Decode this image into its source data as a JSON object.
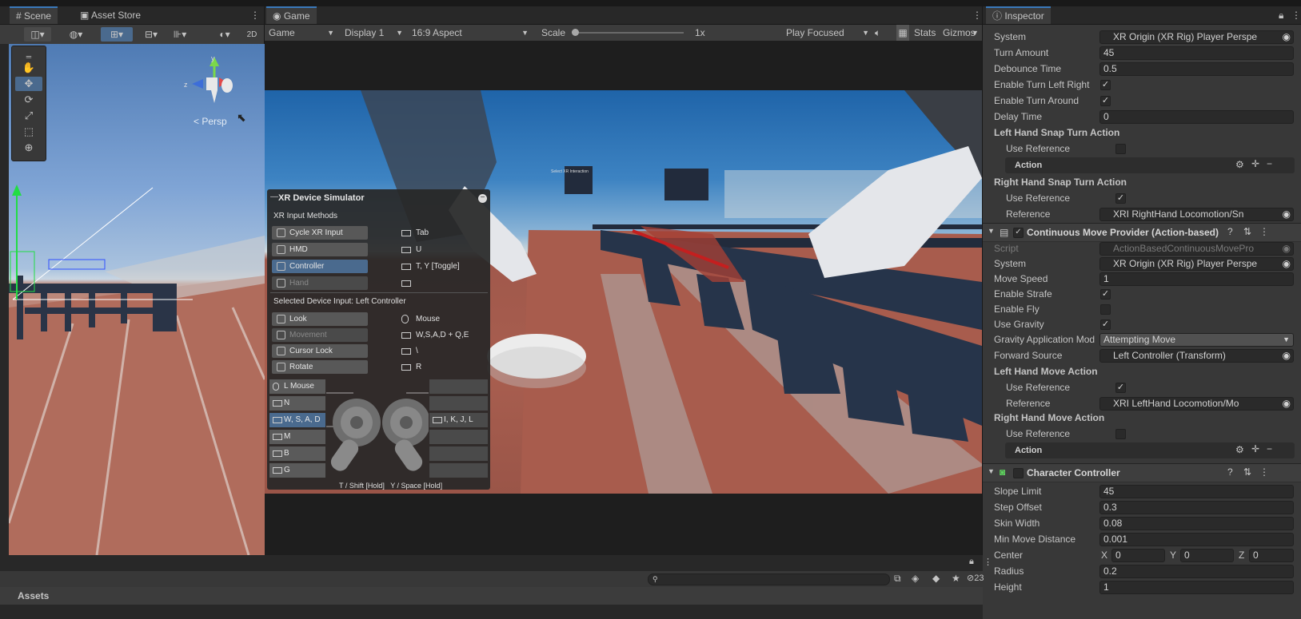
{
  "scene_panel": {
    "tabs": [
      {
        "label": "Scene",
        "icon": "scene-hash-icon"
      },
      {
        "label": "Asset Store",
        "icon": "bag-icon"
      }
    ],
    "persp_label": "< Persp",
    "toolbar_label_2d": "2D"
  },
  "game_panel": {
    "tab_label": "Game",
    "toolbar": {
      "mode": "Game",
      "display": "Display 1",
      "aspect": "16:9 Aspect",
      "scale_label": "Scale",
      "scale_value": "1x",
      "play_mode": "Play Focused",
      "stats": "Stats",
      "gizmos": "Gizmos"
    }
  },
  "xr_simulator": {
    "title": "XR Device Simulator",
    "section_methods": "XR Input Methods",
    "methods": [
      {
        "label": "Cycle XR Input",
        "key": "Tab"
      },
      {
        "label": "HMD",
        "key": "U"
      },
      {
        "label": "Controller",
        "key": "T, Y [Toggle]"
      },
      {
        "label": "Hand",
        "key": ""
      }
    ],
    "selected_input": "Selected Device Input:  Left Controller",
    "inputs": [
      {
        "label": "Look",
        "key": "Mouse"
      },
      {
        "label": "Movement",
        "key": "W,S,A,D + Q,E"
      },
      {
        "label": "Cursor Lock",
        "key": "\\"
      },
      {
        "label": "Rotate",
        "key": "R"
      }
    ],
    "left_list": [
      "L Mouse",
      "N",
      "W, S, A, D",
      "M",
      "B",
      "G"
    ],
    "right_list": [
      "",
      "",
      "I, K, J, L",
      "",
      "",
      ""
    ],
    "footer": "T / Shift [Hold]   Y / Space [Hold]"
  },
  "inspector": {
    "tab_label": "Inspector",
    "rows_top": [
      {
        "label": "System",
        "value": "XR Origin (XR Rig) Player Perspe",
        "type": "object"
      },
      {
        "label": "Turn Amount",
        "value": "45",
        "type": "text"
      },
      {
        "label": "Debounce Time",
        "value": "0.5",
        "type": "text"
      },
      {
        "label": "Enable Turn Left Right",
        "value": "✓",
        "type": "check"
      },
      {
        "label": "Enable Turn Around",
        "value": "✓",
        "type": "check"
      },
      {
        "label": "Delay Time",
        "value": "0",
        "type": "text"
      }
    ],
    "left_snap": {
      "header": "Left Hand Snap Turn Action",
      "use_reference": "Use Reference",
      "action": "Action"
    },
    "right_snap": {
      "header": "Right Hand Snap Turn Action",
      "use_reference": "Use Reference",
      "use_reference_check": "✓",
      "reference_label": "Reference",
      "reference_value": "XRI RightHand Locomotion/Sn"
    },
    "continuous_move": {
      "title": "Continuous Move Provider (Action-based)",
      "script_label": "Script",
      "script_value": "ActionBasedContinuousMovePro",
      "system_label": "System",
      "system_value": "XR Origin (XR Rig) Player Perspe",
      "move_speed_label": "Move Speed",
      "move_speed": "1",
      "enable_strafe_label": "Enable Strafe",
      "enable_strafe": "✓",
      "enable_fly_label": "Enable Fly",
      "use_gravity_label": "Use Gravity",
      "use_gravity": "✓",
      "gravity_mode_label": "Gravity Application Mod",
      "gravity_mode": "Attempting Move",
      "forward_source_label": "Forward Source",
      "forward_source": "Left Controller (Transform)",
      "left_move_header": "Left Hand Move Action",
      "left_use_ref": "Use Reference",
      "left_use_ref_check": "✓",
      "left_reference_label": "Reference",
      "left_reference": "XRI LeftHand Locomotion/Mo",
      "right_move_header": "Right Hand Move Action",
      "right_use_ref": "Use Reference",
      "action": "Action"
    },
    "character_controller": {
      "title": "Character Controller",
      "slope_limit_label": "Slope Limit",
      "slope_limit": "45",
      "step_offset_label": "Step Offset",
      "step_offset": "0.3",
      "skin_width_label": "Skin Width",
      "skin_width": "0.08",
      "min_move_label": "Min Move Distance",
      "min_move": "0.001",
      "center_label": "Center",
      "center_x_label": "X",
      "center_x": "0",
      "center_y_label": "Y",
      "center_y": "0",
      "center_z_label": "Z",
      "center_z": "0",
      "radius_label": "Radius",
      "radius": "0.2",
      "height_label": "Height",
      "height": "1"
    }
  },
  "project_panel": {
    "assets_label": "Assets",
    "hidden_count": "23"
  },
  "colors": {
    "accent": "#3a79bb",
    "panel": "#383838",
    "dark": "#282828"
  }
}
